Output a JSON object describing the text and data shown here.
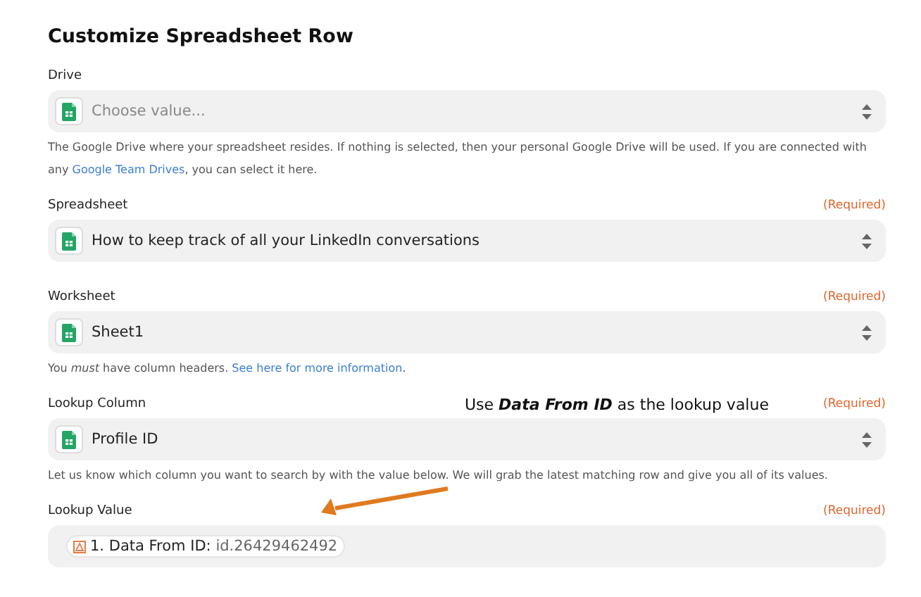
{
  "title": "Customize Spreadsheet Row",
  "fields": [
    {
      "label": "Drive",
      "kind": "select",
      "placeholder": "Choose value...",
      "hint": [
        {
          "text": "The Google Drive where your spreadsheet resides. If nothing is selected, then your personal Google Drive will be used. If you are connected with any ",
          "kind": "text"
        },
        {
          "text": "Google Team Drives",
          "kind": "link"
        },
        {
          "text": ", you can select it here.",
          "kind": "text"
        }
      ]
    },
    {
      "label": "Spreadsheet",
      "required_text": "(Required)",
      "kind": "select",
      "value": "How to keep track of all your LinkedIn conversations"
    },
    {
      "label": "Worksheet",
      "required_text": "(Required)",
      "kind": "select",
      "value": "Sheet1",
      "hint": [
        {
          "text": "You *must* have column headers. ",
          "kind": "text"
        },
        {
          "text": "See here for more information",
          "kind": "link"
        },
        {
          "text": ".",
          "kind": "text"
        }
      ]
    },
    {
      "label": "Lookup Column",
      "required_text": "(Required)",
      "kind": "select",
      "value": "Profile ID",
      "hint": [
        {
          "text": "Let us know which column you want to search by with the value below. We will grab the latest matching row and give you all of its values.",
          "kind": "text"
        }
      ]
    },
    {
      "label": "Lookup Value",
      "required_text": "(Required)",
      "kind": "token",
      "token": {
        "label": "1. Data From ID:",
        "value": "id.26429462492"
      }
    }
  ],
  "annotation": {
    "text": "Use **Data From ID** as the lookup value"
  }
}
